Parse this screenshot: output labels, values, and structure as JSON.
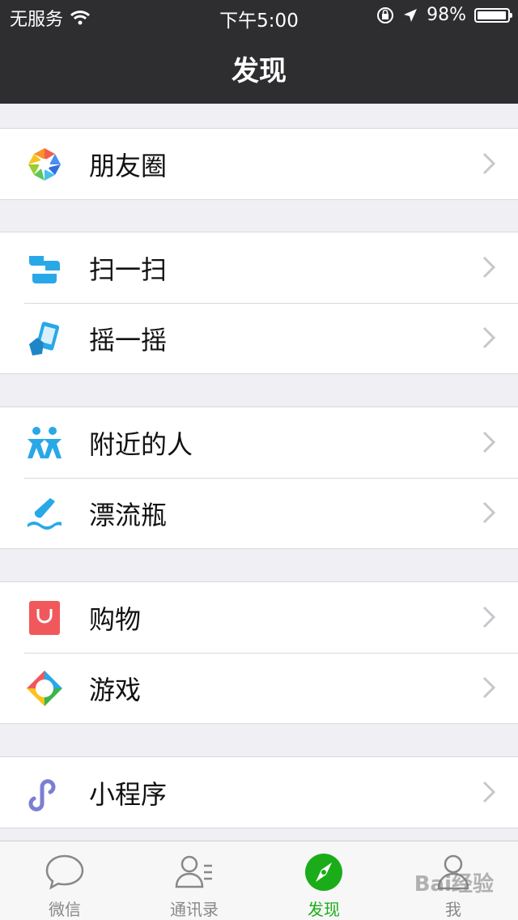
{
  "status_bar": {
    "carrier": "无服务",
    "time": "下午5:00",
    "battery_percent": "98%",
    "battery_level": 0.98,
    "icons": [
      "wifi-icon",
      "orientation-lock-icon",
      "location-arrow-icon",
      "battery-icon"
    ]
  },
  "nav": {
    "title": "发现"
  },
  "sections": [
    {
      "items": [
        {
          "label": "朋友圈",
          "icon": "moments-icon"
        }
      ]
    },
    {
      "items": [
        {
          "label": "扫一扫",
          "icon": "scan-icon"
        },
        {
          "label": "摇一摇",
          "icon": "shake-icon"
        }
      ]
    },
    {
      "items": [
        {
          "label": "附近的人",
          "icon": "people-nearby-icon"
        },
        {
          "label": "漂流瓶",
          "icon": "drift-bottle-icon"
        }
      ]
    },
    {
      "items": [
        {
          "label": "购物",
          "icon": "shopping-icon"
        },
        {
          "label": "游戏",
          "icon": "games-icon"
        }
      ]
    },
    {
      "items": [
        {
          "label": "小程序",
          "icon": "mini-programs-icon"
        }
      ]
    }
  ],
  "tabs": [
    {
      "label": "微信",
      "icon": "chat-bubble-icon",
      "active": false
    },
    {
      "label": "通讯录",
      "icon": "contacts-icon",
      "active": false
    },
    {
      "label": "发现",
      "icon": "compass-icon",
      "active": true
    },
    {
      "label": "我",
      "icon": "me-icon",
      "active": false
    }
  ],
  "colors": {
    "active": "#1aad19",
    "nav_bg": "#2e2e30",
    "page_bg": "#efeff4"
  },
  "watermark": "Bai经验"
}
